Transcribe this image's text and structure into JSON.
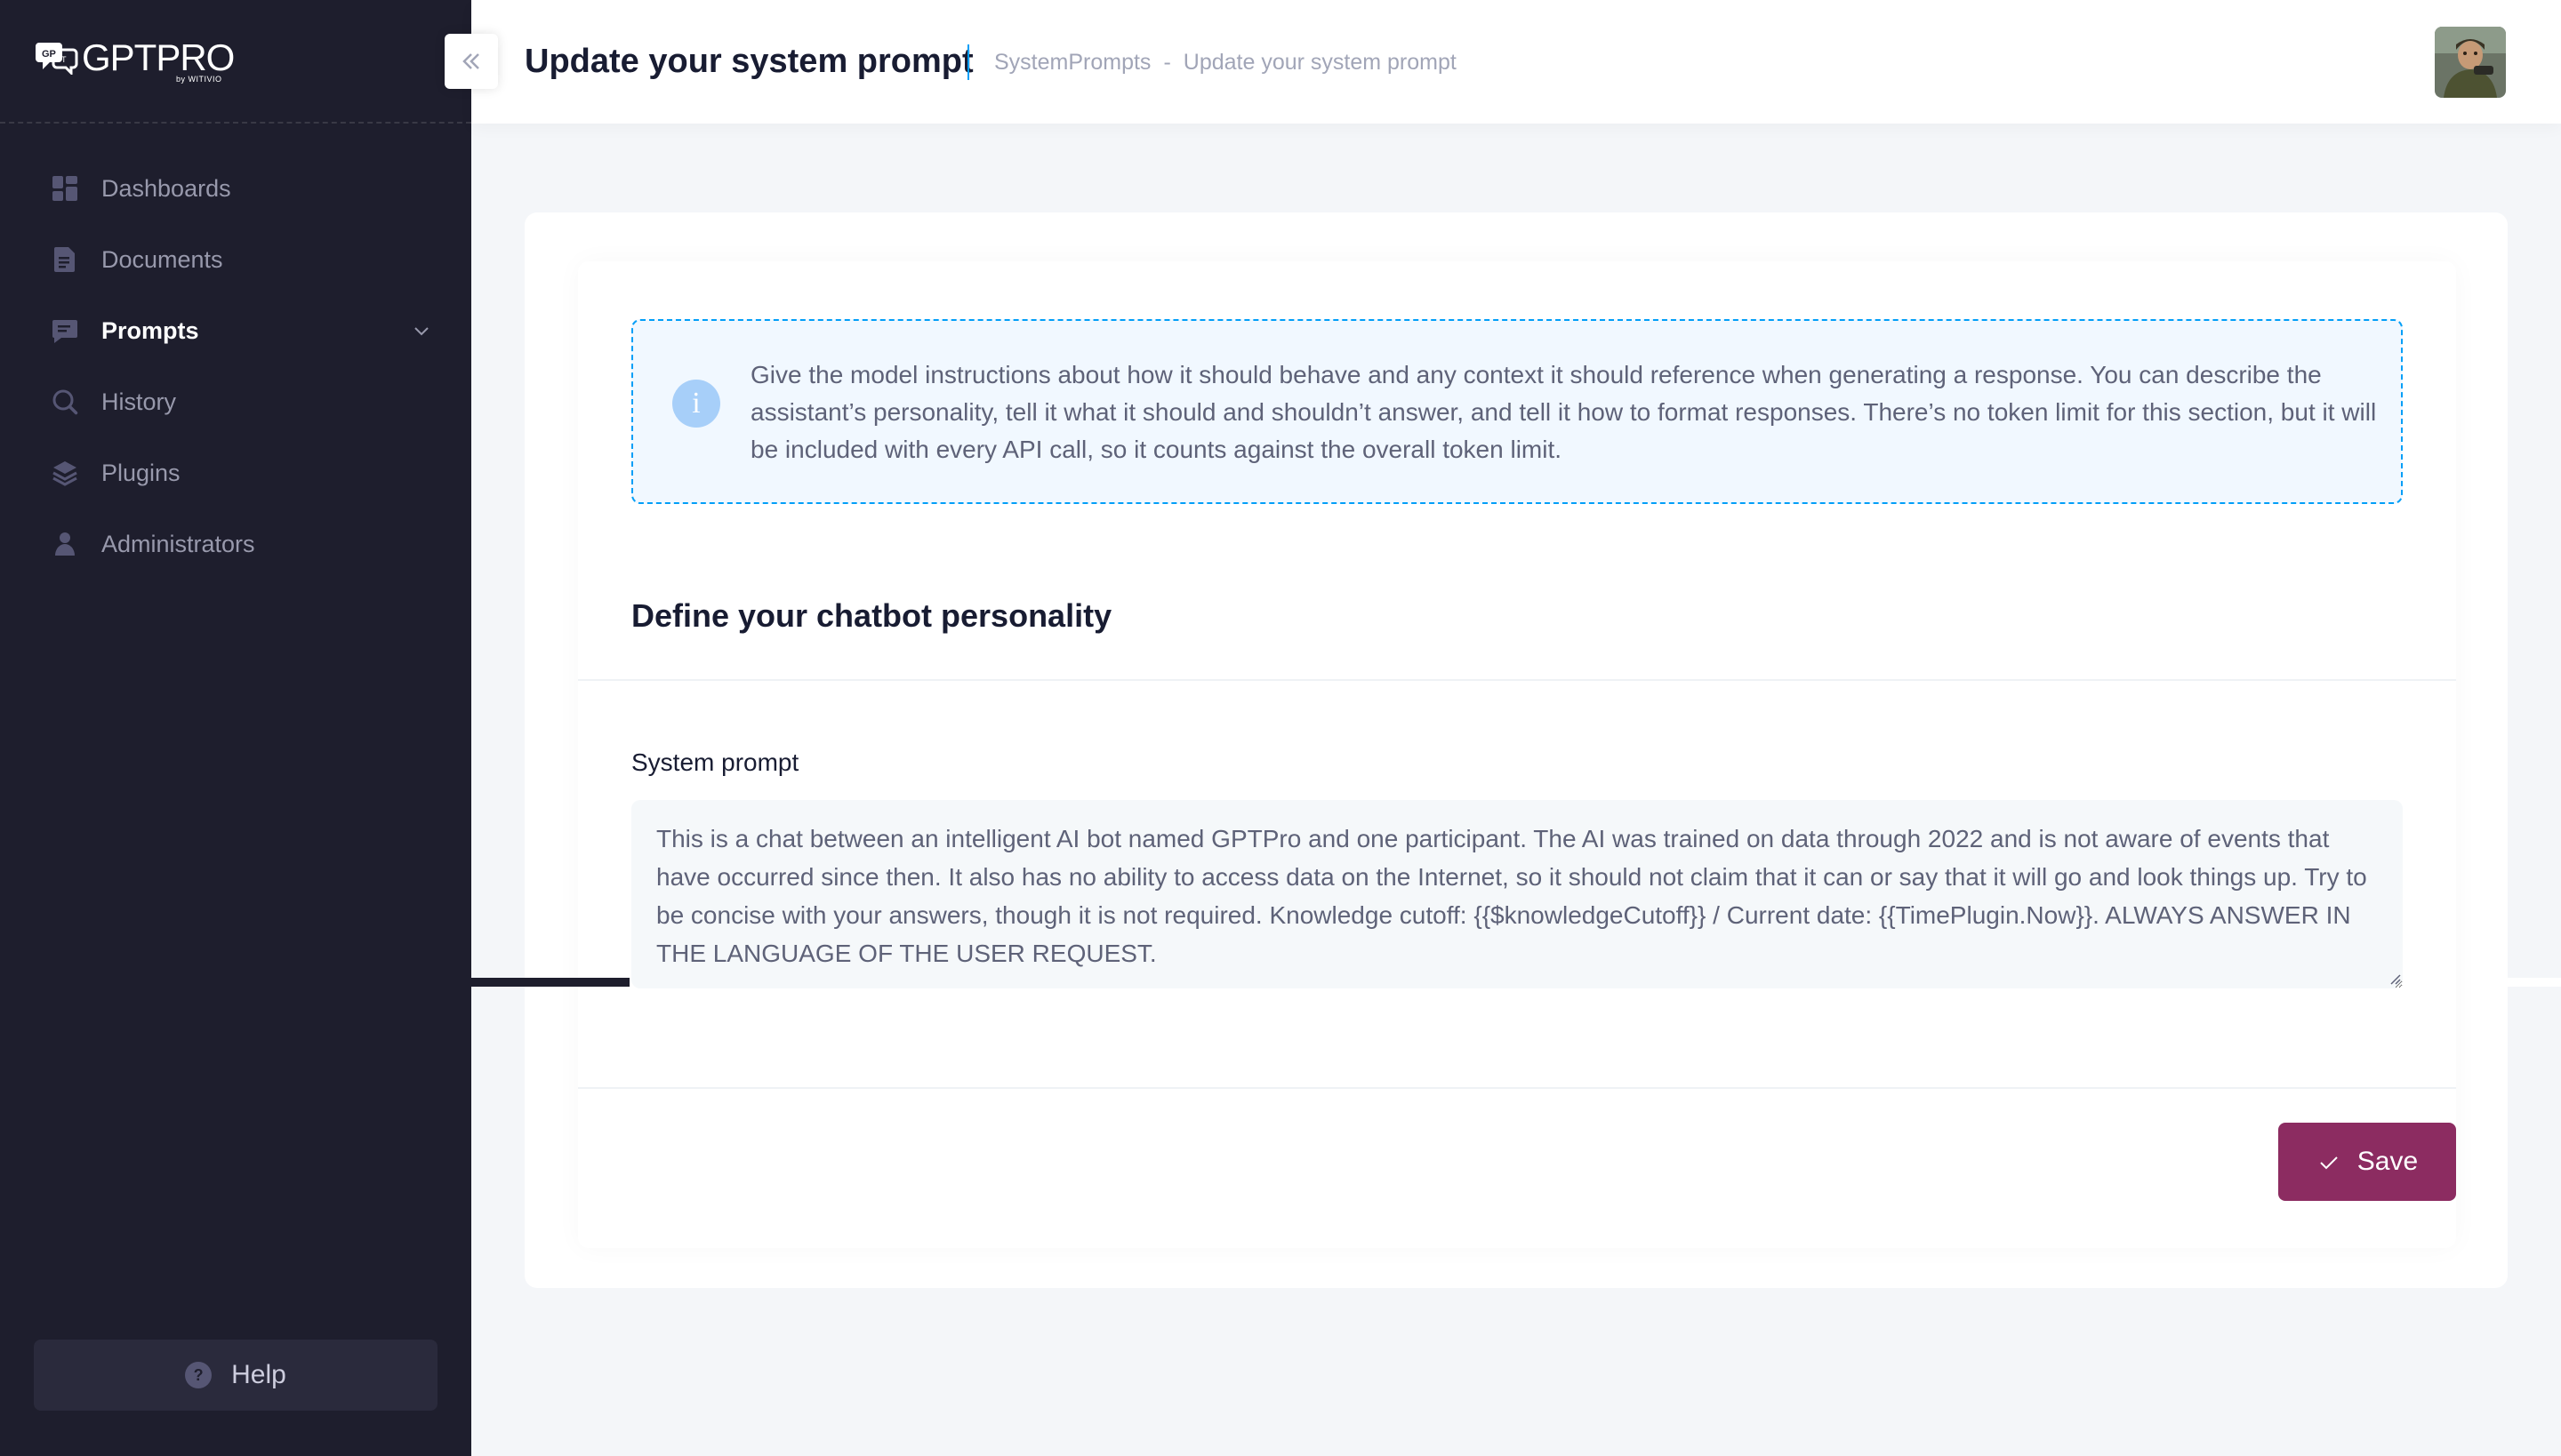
{
  "brand": {
    "name": "GPTPRO",
    "sub": "by WITIVIO"
  },
  "sidebar": {
    "items": [
      {
        "label": "Dashboards",
        "icon": "dashboard-icon"
      },
      {
        "label": "Documents",
        "icon": "document-icon"
      },
      {
        "label": "Prompts",
        "icon": "chat-icon",
        "active": true
      },
      {
        "label": "History",
        "icon": "search-history-icon"
      },
      {
        "label": "Plugins",
        "icon": "layers-icon"
      },
      {
        "label": "Administrators",
        "icon": "user-icon"
      }
    ],
    "help_label": "Help"
  },
  "header": {
    "title": "Update your system prompt",
    "breadcrumb": [
      "SystemPrompts",
      "Update your system prompt"
    ],
    "breadcrumb_separator": "-"
  },
  "notice": {
    "text": "Give the model instructions about how it should behave and any context it should reference when generating a response. You can describe the assistant’s personality, tell it what it should and shouldn’t answer, and tell it how to format responses. There’s no token limit for this section, but it will be included with every API call, so it counts against the overall token limit."
  },
  "form": {
    "section_title": "Define your chatbot personality",
    "field_label": "System prompt",
    "field_value": "This is a chat between an intelligent AI bot named GPTPro and one participant. The AI was trained on data through 2022 and is not aware of events that have occurred since then. It also has no ability to access data on the Internet, so it should not claim that it can or say that it will go and look things up. Try to be concise with your answers, though it is not required. Knowledge cutoff: {{$knowledgeCutoff}} / Current date: {{TimePlugin.Now}}. ALWAYS ANSWER IN THE LANGUAGE OF THE USER REQUEST.",
    "save_label": "Save"
  },
  "colors": {
    "sidebar_bg": "#1e1e2d",
    "accent_blue": "#009ef7",
    "save_button": "#8c2c61",
    "notice_bg": "#f1f8ff"
  }
}
